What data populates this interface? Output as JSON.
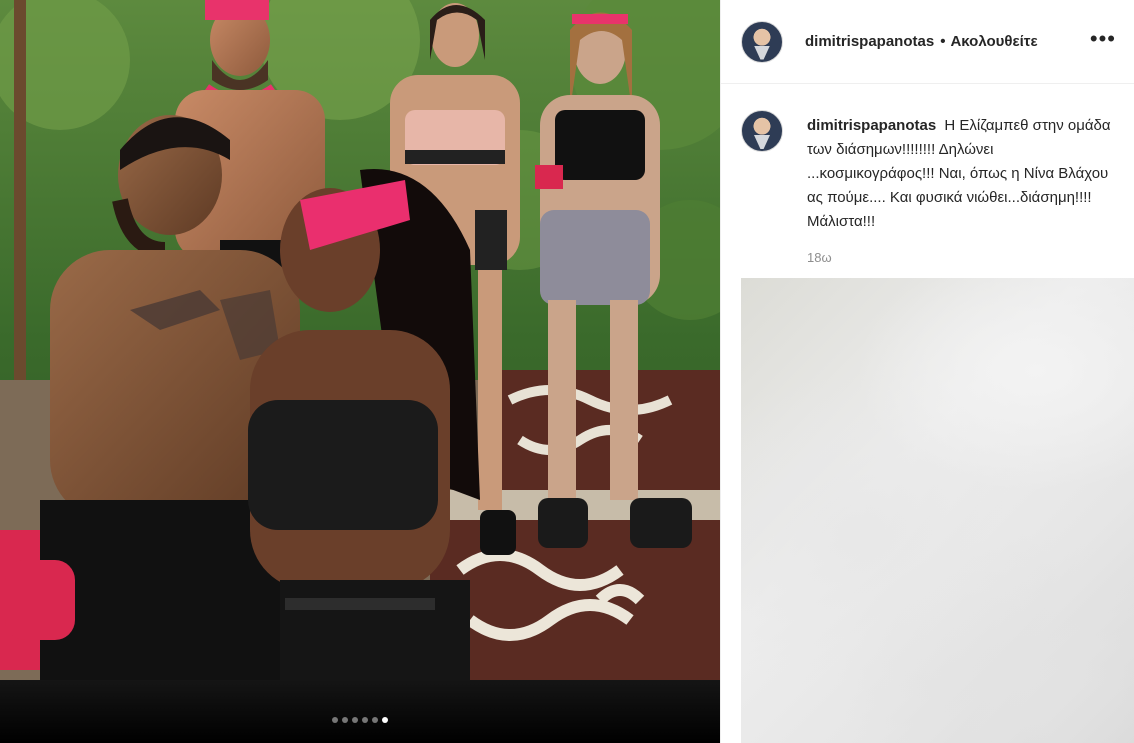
{
  "post": {
    "username": "dimitrispapanotas",
    "separator": "•",
    "follow_status": "Ακολουθείτε",
    "more_label": "•••",
    "caption_user": "dimitrispapanotas",
    "caption_text": "Η Ελίζαμπεθ στην ομάδα των διάσημων!!!!!!!! Δηλώνει ...κοσμικογράφος!!! Ναι, όπως η Νίνα Βλάχου ας πούμε.... Και φυσικά νιώθει...διάσημη!!!! Μάλιστα!!!",
    "timestamp": "18ω"
  },
  "carousel": {
    "total": 6,
    "active_index": 5
  },
  "colors": {
    "accent_pink": "#e8336b",
    "foliage": "#3f6e2f",
    "muted_text": "#8e8e8e"
  },
  "icons": {
    "more": "ellipsis-icon",
    "avatar": "profile-avatar"
  }
}
